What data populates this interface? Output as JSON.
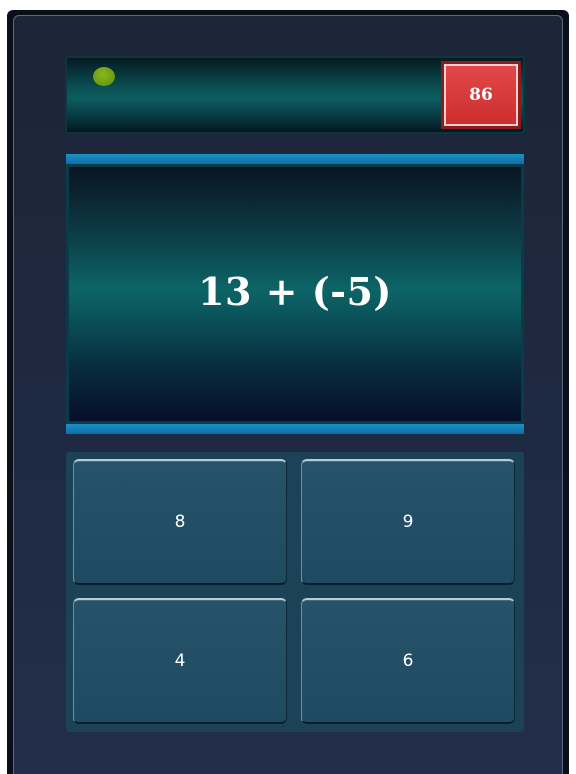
{
  "status": {
    "indicator_color": "#7aa815",
    "timer": "86"
  },
  "question": {
    "expression": "13 + (-5)"
  },
  "answers": [
    {
      "label": "8"
    },
    {
      "label": "9"
    },
    {
      "label": "4"
    },
    {
      "label": "6"
    }
  ],
  "colors": {
    "accent_bar": "#1a86c0",
    "timer_badge": "#d63a3a",
    "panel_bg": "#1e2a42",
    "button_bg": "#224e66"
  }
}
